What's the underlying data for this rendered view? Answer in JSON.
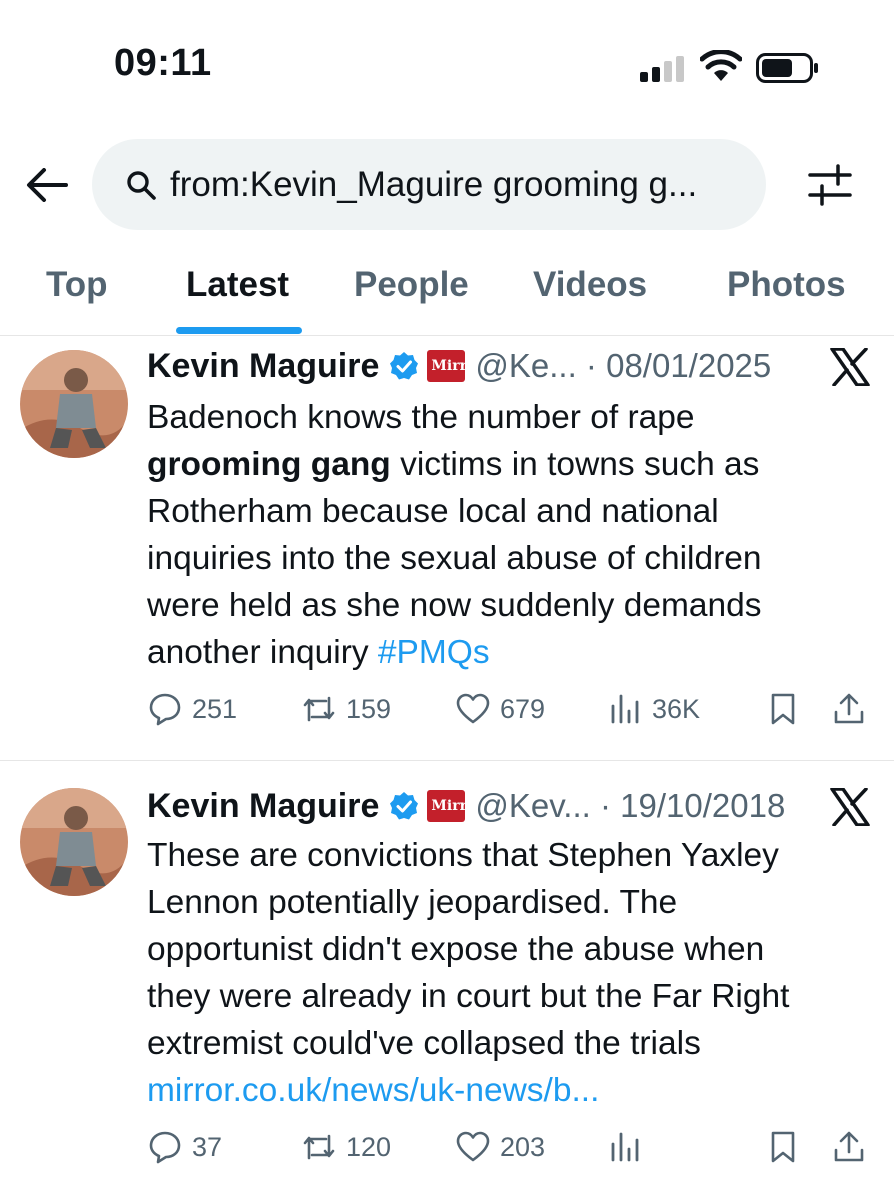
{
  "status_bar": {
    "time": "09:11"
  },
  "search": {
    "query": "from:Kevin_Maguire grooming g..."
  },
  "tabs": [
    {
      "label": "Top"
    },
    {
      "label": "Latest"
    },
    {
      "label": "People"
    },
    {
      "label": "Videos"
    },
    {
      "label": "Photos"
    }
  ],
  "active_tab": "Latest",
  "colors": {
    "accent": "#1d9bf0",
    "text": "#0f1419",
    "muted": "#536471",
    "pill": "#eff3f4",
    "mirror_red": "#c3202b"
  },
  "tweets": [
    {
      "author": "Kevin Maguire",
      "badge_text": "Mirr or",
      "handle_date": "@Ke... · 08/01/2025",
      "text_lines": [
        "Badenoch knows the number of rape",
        "grooming gang",
        " victims in towns such as",
        "Rotherham because local and national",
        "inquiries into the sexual abuse of children",
        "were held as she now suddenly demands",
        "another inquiry ",
        "#PMQs"
      ],
      "replies": "251",
      "reposts": "159",
      "likes": "679",
      "views": "36K"
    },
    {
      "author": "Kevin Maguire",
      "badge_text": "Mirr or",
      "handle_date": "@Kev... · 19/10/2018",
      "text_lines": [
        "These are convictions that Stephen Yaxley",
        "Lennon potentially jeopardised. The",
        "opportunist didn't expose the abuse when",
        "they were already in court but the Far Right",
        "extremist could've collapsed the trials",
        "mirror.co.uk/news/uk-news/b..."
      ],
      "replies": "37",
      "reposts": "120",
      "likes": "203",
      "views": ""
    }
  ],
  "icons": [
    "back-arrow-icon",
    "search-icon",
    "filter-icon",
    "verified-icon",
    "x-logo-icon",
    "reply-icon",
    "repost-icon",
    "like-icon",
    "views-icon",
    "bookmark-icon",
    "share-icon"
  ]
}
